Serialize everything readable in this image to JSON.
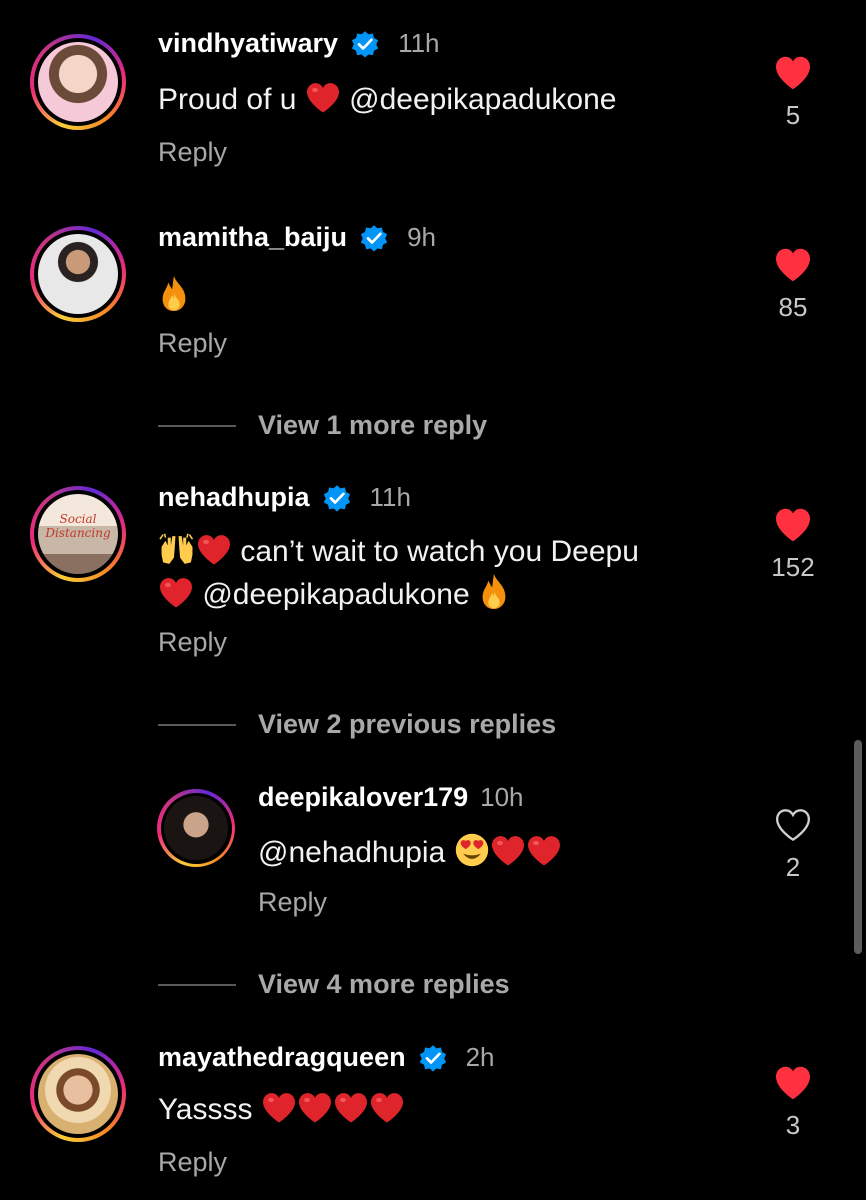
{
  "comments": [
    {
      "username": "vindhyatiwary",
      "time": "11h",
      "text_prefix": "Proud of u",
      "mention": "@deepikapadukone",
      "reply_label": "Reply",
      "likes": "5"
    },
    {
      "username": "mamitha_baiju",
      "time": "9h",
      "reply_label": "Reply",
      "likes": "85"
    },
    {
      "username": "nehadhupia",
      "time": "11h",
      "line1_text": "can’t wait to watch you Deepu",
      "mention": "@deepikapadukone",
      "reply_label": "Reply",
      "likes": "152",
      "avatar_text": "Social Distancing"
    },
    {
      "username": "deepikalover179",
      "time": "10h",
      "mention": "@nehadhupia",
      "reply_label": "Reply",
      "likes": "2"
    },
    {
      "username": "mayathedragqueen",
      "time": "2h",
      "text_prefix": "Yassss",
      "reply_label": "Reply",
      "likes": "3"
    }
  ],
  "view_replies": {
    "first": "View 1 more reply",
    "second": "View 2 previous replies",
    "third": "View 4 more replies"
  },
  "colors": {
    "background": "#000000",
    "liked_heart": "#ff3040",
    "verified": "#0095f6",
    "secondary_text": "#a8a8a8"
  }
}
